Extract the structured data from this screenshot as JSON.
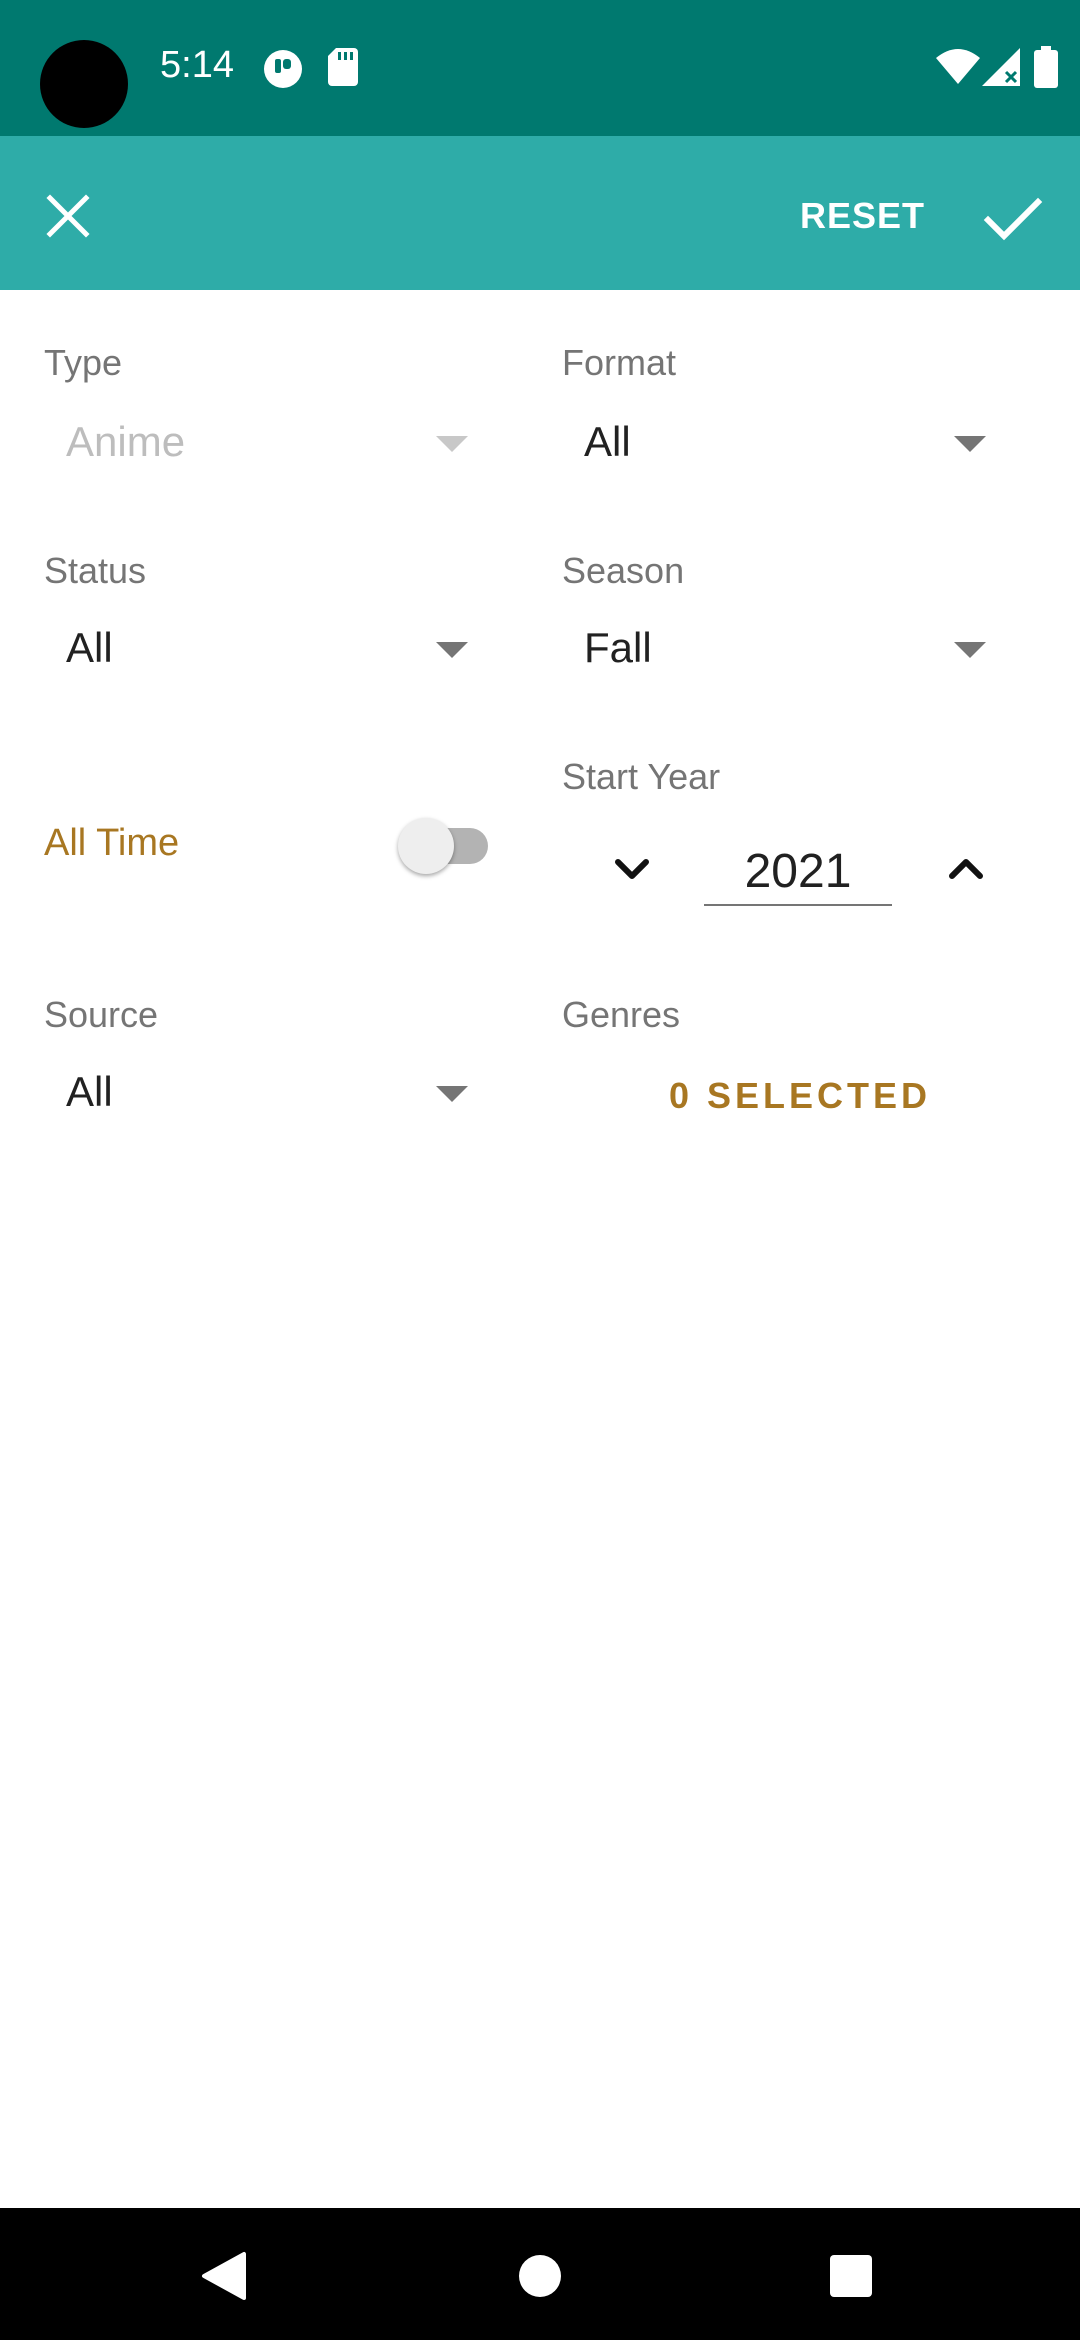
{
  "status_bar": {
    "time": "5:14",
    "icons": [
      "camera-cutout",
      "app-notification-icon",
      "sd-card-icon",
      "wifi-icon",
      "cell-signal-icon",
      "battery-icon"
    ]
  },
  "toolbar": {
    "close_icon": "close-icon",
    "reset_label": "RESET",
    "confirm_icon": "check-icon"
  },
  "filters": {
    "type": {
      "label": "Type",
      "value": "Anime",
      "enabled": false
    },
    "format": {
      "label": "Format",
      "value": "All"
    },
    "status": {
      "label": "Status",
      "value": "All"
    },
    "season": {
      "label": "Season",
      "value": "Fall"
    },
    "all_time": {
      "label": "All Time",
      "enabled": false
    },
    "start_year": {
      "label": "Start Year",
      "value": "2021"
    },
    "source": {
      "label": "Source",
      "value": "All"
    },
    "genres": {
      "label": "Genres",
      "button_label": "0 SELECTED"
    }
  },
  "colors": {
    "status_bar": "#00796f",
    "toolbar": "#2eaca8",
    "accent": "#a87722"
  },
  "nav_bar": {
    "icons": [
      "back-icon",
      "home-icon",
      "recents-icon"
    ]
  }
}
